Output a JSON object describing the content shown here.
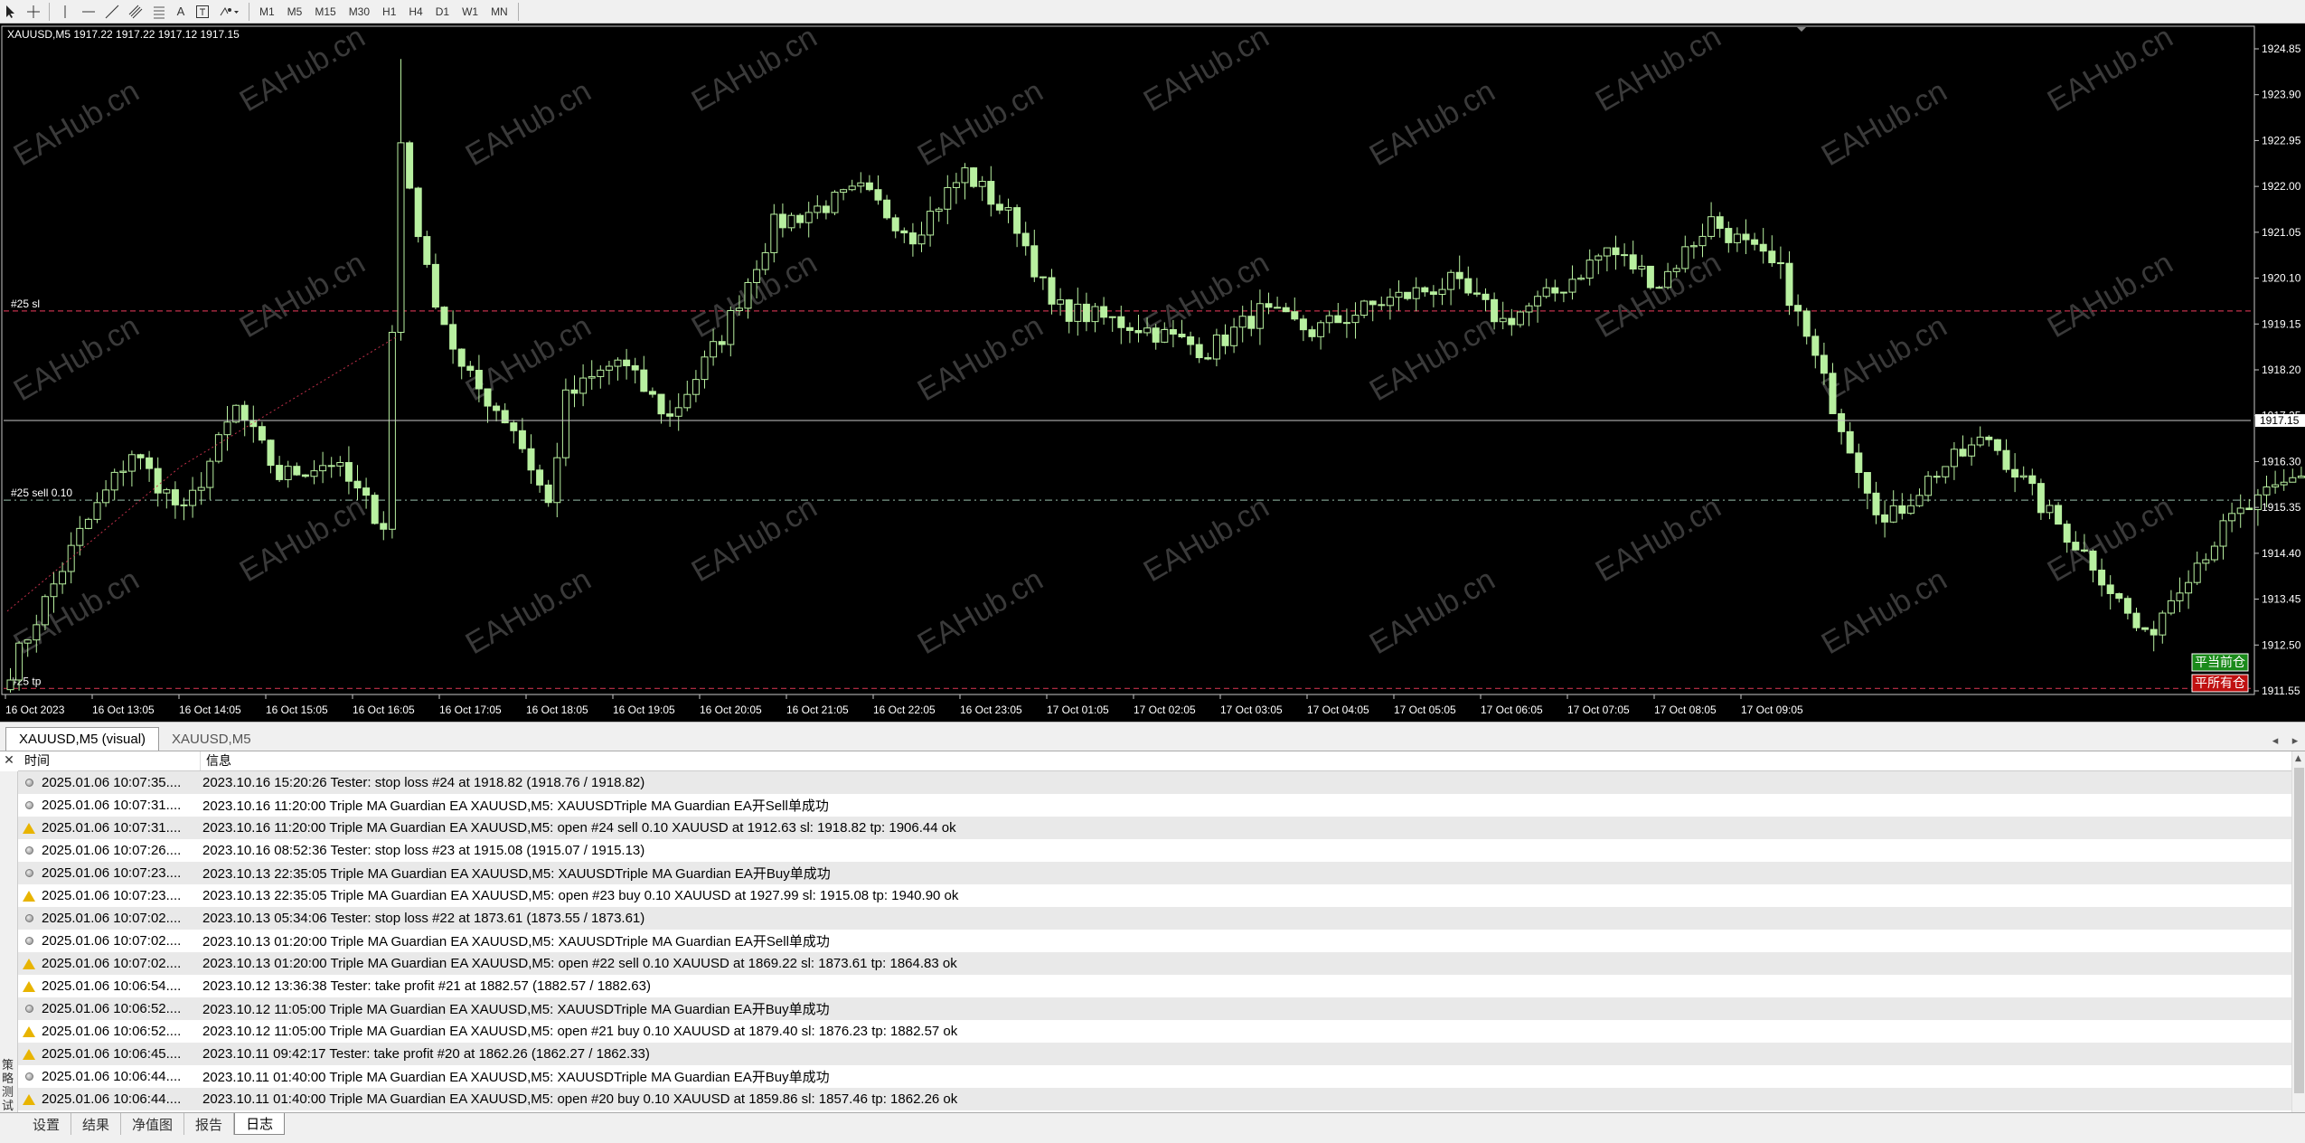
{
  "toolbar": {
    "timeframes": [
      "M1",
      "M5",
      "M15",
      "M30",
      "H1",
      "H4",
      "D1",
      "W1",
      "MN"
    ],
    "text_tool_label": "A"
  },
  "chart": {
    "header": "XAUUSD,M5  1917.22 1917.22 1917.12 1917.15",
    "watermark": "EAHub.cn",
    "current_price_label": "1917.15",
    "order_lines": [
      {
        "label": "#25 sl",
        "price": 1919.42,
        "color": "#c0304a",
        "style": "dashed"
      },
      {
        "label": "#25 sell 0.10",
        "price": 1915.5,
        "color": "#7a9a8a",
        "style": "dashdot"
      },
      {
        "label": "#25 tp",
        "price": 1911.6,
        "color": "#c0304a",
        "style": "dashed"
      }
    ],
    "close_current_label": "平当前仓",
    "close_all_label": "平所有仓",
    "colors": {
      "candle": "#b8f0a0",
      "grid": "#000000",
      "axis_text": "#ffffff",
      "close_current_bg": "#1a8a1a",
      "close_all_bg": "#c01010"
    }
  },
  "chart_data": {
    "type": "candlestick",
    "symbol": "XAUUSD",
    "timeframe": "M5",
    "y_ticks": [
      1924.85,
      1923.9,
      1922.95,
      1922.0,
      1921.05,
      1920.1,
      1919.15,
      1918.2,
      1917.25,
      1916.3,
      1915.35,
      1914.4,
      1913.45,
      1912.5,
      1911.55
    ],
    "ylim": [
      1911.2,
      1925.3
    ],
    "x_ticks": [
      "16 Oct 2023",
      "16 Oct 13:05",
      "16 Oct 14:05",
      "16 Oct 15:05",
      "16 Oct 16:05",
      "16 Oct 17:05",
      "16 Oct 18:05",
      "16 Oct 19:05",
      "16 Oct 20:05",
      "16 Oct 21:05",
      "16 Oct 22:05",
      "16 Oct 23:05",
      "17 Oct 01:05",
      "17 Oct 02:05",
      "17 Oct 03:05",
      "17 Oct 04:05",
      "17 Oct 05:05",
      "17 Oct 06:05",
      "17 Oct 07:05",
      "17 Oct 08:05",
      "17 Oct 09:05"
    ],
    "path": [
      [
        0,
        1912.0
      ],
      [
        8,
        1914.8
      ],
      [
        14,
        1916.5
      ],
      [
        20,
        1915.2
      ],
      [
        26,
        1917.4
      ],
      [
        31,
        1916.0
      ],
      [
        37,
        1916.3
      ],
      [
        43,
        1915.0
      ],
      [
        45,
        1922.9
      ],
      [
        48,
        1920.2
      ],
      [
        52,
        1918.2
      ],
      [
        58,
        1917.0
      ],
      [
        62,
        1915.4
      ],
      [
        64,
        1917.6
      ],
      [
        70,
        1918.4
      ],
      [
        76,
        1917.2
      ],
      [
        82,
        1918.9
      ],
      [
        88,
        1921.2
      ],
      [
        98,
        1921.9
      ],
      [
        104,
        1921.0
      ],
      [
        110,
        1922.3
      ],
      [
        116,
        1921.2
      ],
      [
        120,
        1919.5
      ],
      [
        130,
        1919.1
      ],
      [
        138,
        1918.6
      ],
      [
        144,
        1919.4
      ],
      [
        150,
        1919.0
      ],
      [
        158,
        1919.6
      ],
      [
        166,
        1920.0
      ],
      [
        172,
        1919.2
      ],
      [
        178,
        1919.8
      ],
      [
        184,
        1920.7
      ],
      [
        190,
        1920.0
      ],
      [
        196,
        1921.3
      ],
      [
        204,
        1920.2
      ],
      [
        210,
        1917.5
      ],
      [
        216,
        1915.0
      ],
      [
        222,
        1916.1
      ],
      [
        228,
        1916.8
      ],
      [
        234,
        1915.4
      ],
      [
        240,
        1914.2
      ],
      [
        246,
        1912.6
      ],
      [
        250,
        1913.8
      ],
      [
        256,
        1915.1
      ],
      [
        262,
        1915.8
      ],
      [
        268,
        1916.6
      ],
      [
        274,
        1915.7
      ],
      [
        280,
        1915.2
      ],
      [
        286,
        1915.9
      ],
      [
        292,
        1914.9
      ],
      [
        298,
        1916.2
      ],
      [
        304,
        1915.4
      ],
      [
        308,
        1914.8
      ],
      [
        314,
        1917.2
      ],
      [
        318,
        1917.9
      ],
      [
        322,
        1917.4
      ],
      [
        325,
        1917.15
      ]
    ],
    "total_bars": 326
  },
  "chart_tabs": [
    "XAUUSD,M5 (visual)",
    "XAUUSD,M5"
  ],
  "terminal": {
    "columns": {
      "time": "时间",
      "message": "信息"
    },
    "side_label": "策略测试",
    "rows": [
      {
        "icon": "info",
        "time": "2025.01.06 10:07:35....",
        "message": "2023.10.16 15:20:26  Tester: stop loss #24 at 1918.82 (1918.76 / 1918.82)"
      },
      {
        "icon": "info",
        "time": "2025.01.06 10:07:31....",
        "message": "2023.10.16 11:20:00  Triple MA Guardian EA XAUUSD,M5: XAUUSDTriple MA Guardian EA开Sell单成功"
      },
      {
        "icon": "warn",
        "time": "2025.01.06 10:07:31....",
        "message": "2023.10.16 11:20:00  Triple MA Guardian EA XAUUSD,M5: open #24 sell 0.10 XAUUSD at 1912.63 sl: 1918.82 tp: 1906.44 ok"
      },
      {
        "icon": "info",
        "time": "2025.01.06 10:07:26....",
        "message": "2023.10.16 08:52:36  Tester: stop loss #23 at 1915.08 (1915.07 / 1915.13)"
      },
      {
        "icon": "info",
        "time": "2025.01.06 10:07:23....",
        "message": "2023.10.13 22:35:05  Triple MA Guardian EA XAUUSD,M5: XAUUSDTriple MA Guardian EA开Buy单成功"
      },
      {
        "icon": "warn",
        "time": "2025.01.06 10:07:23....",
        "message": "2023.10.13 22:35:05  Triple MA Guardian EA XAUUSD,M5: open #23 buy 0.10 XAUUSD at 1927.99 sl: 1915.08 tp: 1940.90 ok"
      },
      {
        "icon": "info",
        "time": "2025.01.06 10:07:02....",
        "message": "2023.10.13 05:34:06  Tester: stop loss #22 at 1873.61 (1873.55 / 1873.61)"
      },
      {
        "icon": "info",
        "time": "2025.01.06 10:07:02....",
        "message": "2023.10.13 01:20:00  Triple MA Guardian EA XAUUSD,M5: XAUUSDTriple MA Guardian EA开Sell单成功"
      },
      {
        "icon": "warn",
        "time": "2025.01.06 10:07:02....",
        "message": "2023.10.13 01:20:00  Triple MA Guardian EA XAUUSD,M5: open #22 sell 0.10 XAUUSD at 1869.22 sl: 1873.61 tp: 1864.83 ok"
      },
      {
        "icon": "warn",
        "time": "2025.01.06 10:06:54....",
        "message": "2023.10.12 13:36:38  Tester: take profit #21 at 1882.57 (1882.57 / 1882.63)"
      },
      {
        "icon": "info",
        "time": "2025.01.06 10:06:52....",
        "message": "2023.10.12 11:05:00  Triple MA Guardian EA XAUUSD,M5: XAUUSDTriple MA Guardian EA开Buy单成功"
      },
      {
        "icon": "warn",
        "time": "2025.01.06 10:06:52....",
        "message": "2023.10.12 11:05:00  Triple MA Guardian EA XAUUSD,M5: open #21 buy 0.10 XAUUSD at 1879.40 sl: 1876.23 tp: 1882.57 ok"
      },
      {
        "icon": "warn",
        "time": "2025.01.06 10:06:45....",
        "message": "2023.10.11 09:42:17  Tester: take profit #20 at 1862.26 (1862.27 / 1862.33)"
      },
      {
        "icon": "info",
        "time": "2025.01.06 10:06:44....",
        "message": "2023.10.11 01:40:00  Triple MA Guardian EA XAUUSD,M5: XAUUSDTriple MA Guardian EA开Buy单成功"
      },
      {
        "icon": "warn",
        "time": "2025.01.06 10:06:44....",
        "message": "2023.10.11 01:40:00  Triple MA Guardian EA XAUUSD,M5: open #20 buy 0.10 XAUUSD at 1859.86 sl: 1857.46 tp: 1862.26 ok"
      }
    ]
  },
  "bottom_tabs": [
    "设置",
    "结果",
    "净值图",
    "报告",
    "日志"
  ],
  "bottom_active": "日志"
}
